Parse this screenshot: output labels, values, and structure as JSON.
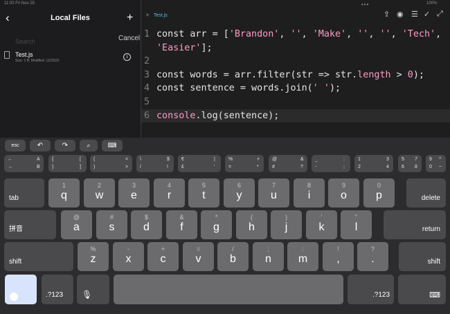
{
  "status": {
    "time": "11:00 Fri Nov 25",
    "battery": "100%"
  },
  "sidebar": {
    "title": "Local Files",
    "search_placeholder": "Search",
    "cancel_label": "Cancel",
    "file": {
      "name": "Test.js",
      "meta": "Size: 1 B, Modified: 11/25/22"
    }
  },
  "editor": {
    "tab_label": "Test.js",
    "lines": [
      {
        "num": "1",
        "text": "const arr = ['Brandon', '', 'Make', '', '', 'Tech',\n'Easier'];"
      },
      {
        "num": "2",
        "text": ""
      },
      {
        "num": "3",
        "text": "const words = arr.filter(str => str.length > 0);"
      },
      {
        "num": "4",
        "text": "const sentence = words.join(' ');"
      },
      {
        "num": "5",
        "text": ""
      },
      {
        "num": "6",
        "text": "console.log(sentence);"
      }
    ]
  },
  "keyboard": {
    "accessory": {
      "esc": "esc"
    },
    "symbols": [
      [
        "←",
        "→",
        "A",
        "B"
      ],
      [
        "{",
        "}",
        "[",
        "]"
      ],
      [
        "(",
        ")",
        "<",
        ">"
      ],
      [
        "\\",
        "/",
        "$",
        "!"
      ],
      [
        "€",
        "£",
        "|",
        "'"
      ],
      [
        "%",
        "=",
        "+",
        "*"
      ],
      [
        "@",
        "#",
        "&",
        "?"
      ],
      [
        "_",
        "-",
        ":",
        ";"
      ],
      [
        "1",
        "2",
        "3",
        "4"
      ],
      [
        "5",
        "6",
        "7",
        "8"
      ],
      [
        "9",
        "0",
        "^",
        "~"
      ]
    ],
    "row1": [
      {
        "hint": "1",
        "letter": "q"
      },
      {
        "hint": "2",
        "letter": "w"
      },
      {
        "hint": "3",
        "letter": "e"
      },
      {
        "hint": "4",
        "letter": "r"
      },
      {
        "hint": "5",
        "letter": "t"
      },
      {
        "hint": "6",
        "letter": "y"
      },
      {
        "hint": "7",
        "letter": "u"
      },
      {
        "hint": "8",
        "letter": "i"
      },
      {
        "hint": "9",
        "letter": "o"
      },
      {
        "hint": "0",
        "letter": "p"
      }
    ],
    "row2": [
      {
        "hint": "@",
        "letter": "a"
      },
      {
        "hint": "#",
        "letter": "s"
      },
      {
        "hint": "$",
        "letter": "d"
      },
      {
        "hint": "&",
        "letter": "f"
      },
      {
        "hint": "*",
        "letter": "g"
      },
      {
        "hint": "(",
        "letter": "h"
      },
      {
        "hint": ")",
        "letter": "j"
      },
      {
        "hint": "'",
        "letter": "k"
      },
      {
        "hint": "\"",
        "letter": "l"
      }
    ],
    "row3": [
      {
        "hint": "%",
        "letter": "z"
      },
      {
        "hint": "-",
        "letter": "x"
      },
      {
        "hint": "+",
        "letter": "c"
      },
      {
        "hint": "=",
        "letter": "v"
      },
      {
        "hint": "/",
        "letter": "b"
      },
      {
        "hint": ";",
        "letter": "n"
      },
      {
        "hint": ":",
        "letter": "m"
      },
      {
        "hint": "!",
        "letter": ","
      },
      {
        "hint": "?",
        "letter": "."
      }
    ],
    "tab": "tab",
    "delete": "delete",
    "pinyin": "拼音",
    "return": "return",
    "shift": "shift",
    "numbers": ".?123"
  }
}
